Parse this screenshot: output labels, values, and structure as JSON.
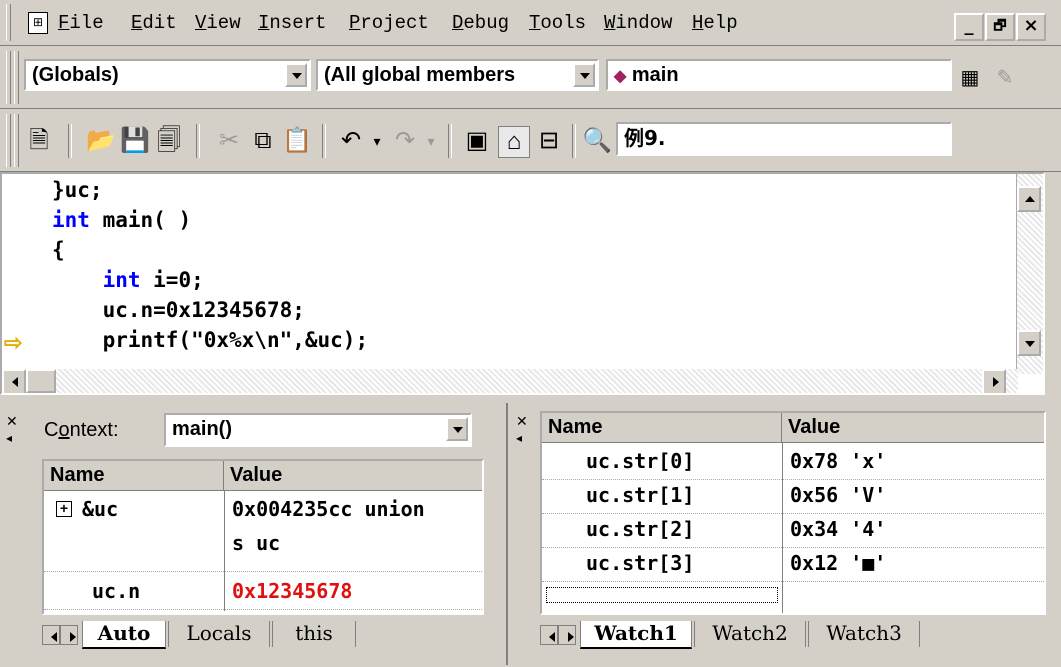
{
  "menu": {
    "items": [
      {
        "key": "F",
        "rest": "ile"
      },
      {
        "key": "E",
        "rest": "dit"
      },
      {
        "key": "V",
        "rest": "iew"
      },
      {
        "key": "I",
        "rest": "nsert"
      },
      {
        "key": "P",
        "rest": "roject"
      },
      {
        "key": "D",
        "rest": "ebug"
      },
      {
        "key": "T",
        "rest": "ools"
      },
      {
        "key": "W",
        "rest": "indow"
      },
      {
        "key": "H",
        "rest": "elp"
      }
    ],
    "minimize": "_",
    "restore": "🗗",
    "close": "×"
  },
  "wizard": {
    "class_combo": "(Globals)",
    "filter_combo": "(All global members",
    "member_combo": "main",
    "member_icon": "◆"
  },
  "toolbar": {
    "find_text": "例9."
  },
  "editor": {
    "lines": [
      {
        "indent": "",
        "kw": "",
        "text": "}uc;"
      },
      {
        "indent": "",
        "kw": "int",
        "text": " main( )"
      },
      {
        "indent": "",
        "kw": "",
        "text": "{"
      },
      {
        "indent": "    ",
        "kw": "int",
        "text": " i=0;"
      },
      {
        "indent": "    ",
        "kw": "",
        "text": "uc.n=0x12345678;"
      },
      {
        "indent": "    ",
        "kw": "",
        "text": "printf(\"0x%x\\n\",&uc);"
      }
    ],
    "current_line_marker": "⇨"
  },
  "variables": {
    "context_label_pre": "C",
    "context_label_key": "o",
    "context_label_post": "ntext:",
    "context_value": "main()",
    "headers": {
      "name": "Name",
      "value": "Value"
    },
    "rows": [
      {
        "expander": "+",
        "name": "&uc",
        "value": "0x004235cc union",
        "value2": "s uc"
      },
      {
        "expander": "",
        "name": "uc.n",
        "value": "0x12345678",
        "value2": ""
      }
    ],
    "tabs": [
      "Auto",
      "Locals",
      "this"
    ],
    "changed_color": "#e01010"
  },
  "watch": {
    "headers": {
      "name": "Name",
      "value": "Value"
    },
    "rows": [
      {
        "name": "uc.str[0]",
        "value": "0x78 'x'"
      },
      {
        "name": "uc.str[1]",
        "value": "0x56 'V'"
      },
      {
        "name": "uc.str[2]",
        "value": "0x34 '4'"
      },
      {
        "name": "uc.str[3]",
        "value": "0x12 '■'"
      }
    ],
    "tabs": [
      "Watch1",
      "Watch2",
      "Watch3"
    ]
  }
}
